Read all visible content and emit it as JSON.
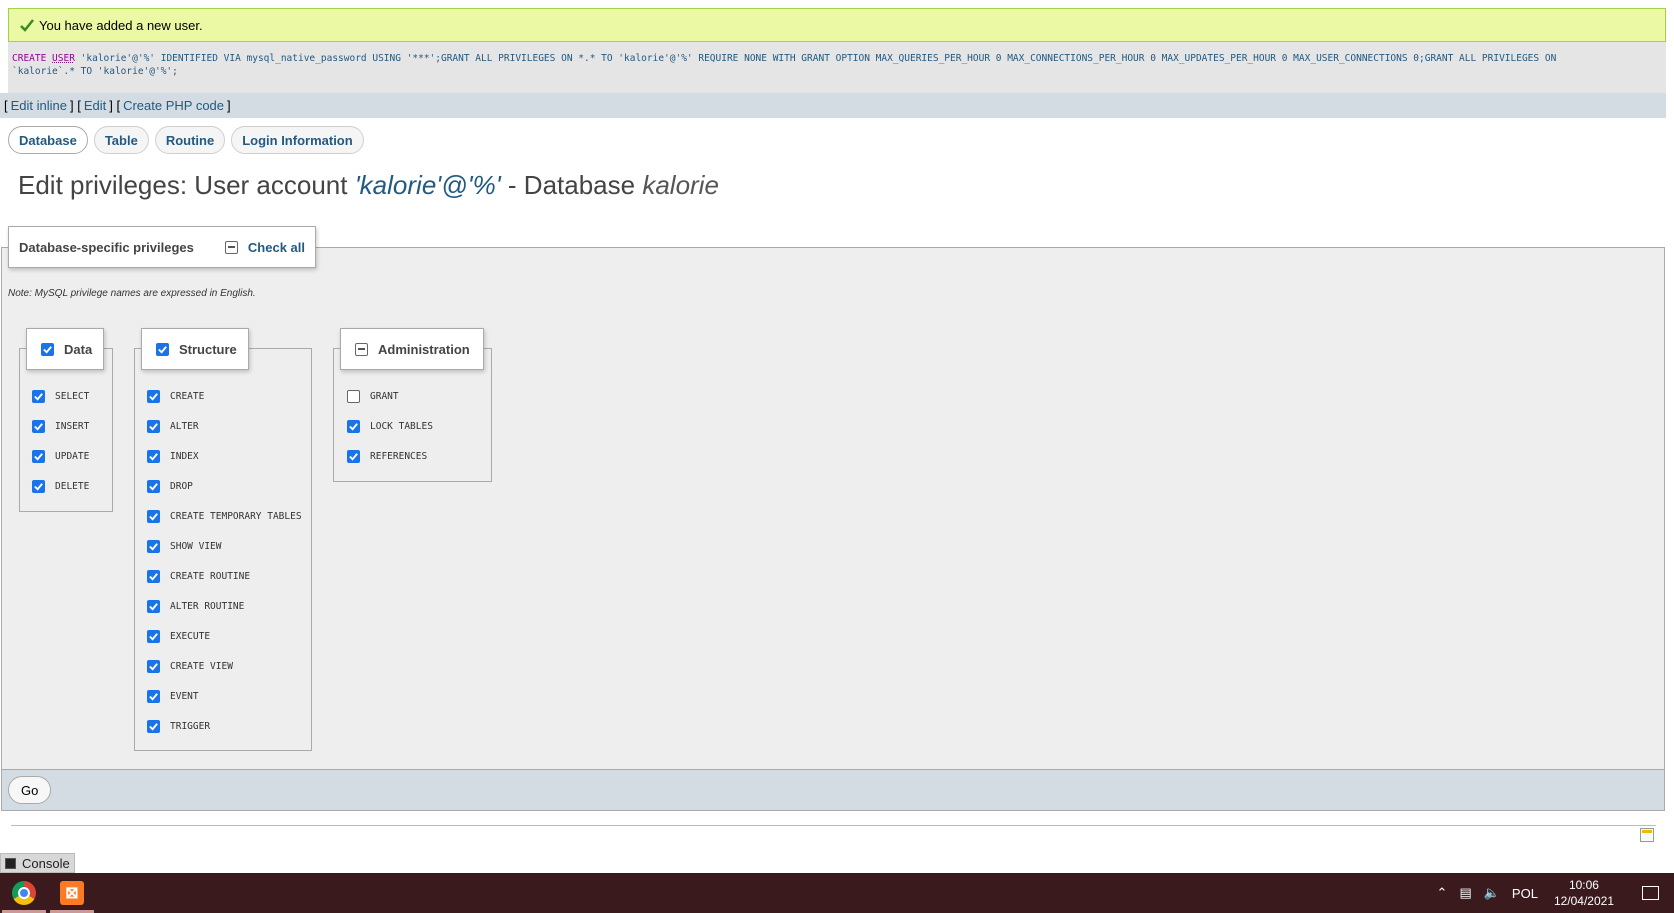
{
  "notice": {
    "message": "You have added a new user."
  },
  "sql": {
    "line1_a": "CREATE ",
    "line1_user": "USER",
    "line1_b": " 'kalorie'@'%' IDENTIFIED VIA mysql_native_password USING '***';GRANT ALL PRIVILEGES ON *.* TO 'kalorie'@'%' REQUIRE NONE WITH GRANT OPTION MAX_QUERIES_PER_HOUR 0 MAX_CONNECTIONS_PER_HOUR 0 MAX_UPDATES_PER_HOUR 0 MAX_USER_CONNECTIONS 0;GRANT ALL PRIVILEGES ON",
    "line2": "`kalorie`.* TO 'kalorie'@'%';"
  },
  "sql_tools": {
    "edit_inline": "Edit inline",
    "edit": "Edit",
    "create_php": "Create PHP code"
  },
  "tabs": [
    {
      "label": "Database"
    },
    {
      "label": "Table"
    },
    {
      "label": "Routine"
    },
    {
      "label": "Login Information"
    }
  ],
  "title": {
    "prefix": "Edit privileges: User account ",
    "account": "'kalorie'@'%'",
    "mid": " - Database ",
    "database": "kalorie"
  },
  "privileges": {
    "legend": "Database-specific privileges",
    "check_all": "Check all",
    "note": "Note: MySQL privilege names are expressed in English.",
    "groups": {
      "data": {
        "label": "Data",
        "items": [
          "SELECT",
          "INSERT",
          "UPDATE",
          "DELETE"
        ]
      },
      "structure": {
        "label": "Structure",
        "items": [
          "CREATE",
          "ALTER",
          "INDEX",
          "DROP",
          "CREATE TEMPORARY TABLES",
          "SHOW VIEW",
          "CREATE ROUTINE",
          "ALTER ROUTINE",
          "EXECUTE",
          "CREATE VIEW",
          "EVENT",
          "TRIGGER"
        ]
      },
      "administration": {
        "label": "Administration",
        "items": [
          "GRANT",
          "LOCK TABLES",
          "REFERENCES"
        ],
        "checked": [
          false,
          true,
          true
        ]
      }
    }
  },
  "go_button": "Go",
  "console": "Console",
  "taskbar": {
    "language": "POL",
    "time": "10:06",
    "date": "12/04/2021"
  },
  "colors": {
    "link": "#235a81",
    "success_bg": "#ebf8a4",
    "checkbox": "#1a73e8",
    "taskbar": "#3b1a1e"
  }
}
